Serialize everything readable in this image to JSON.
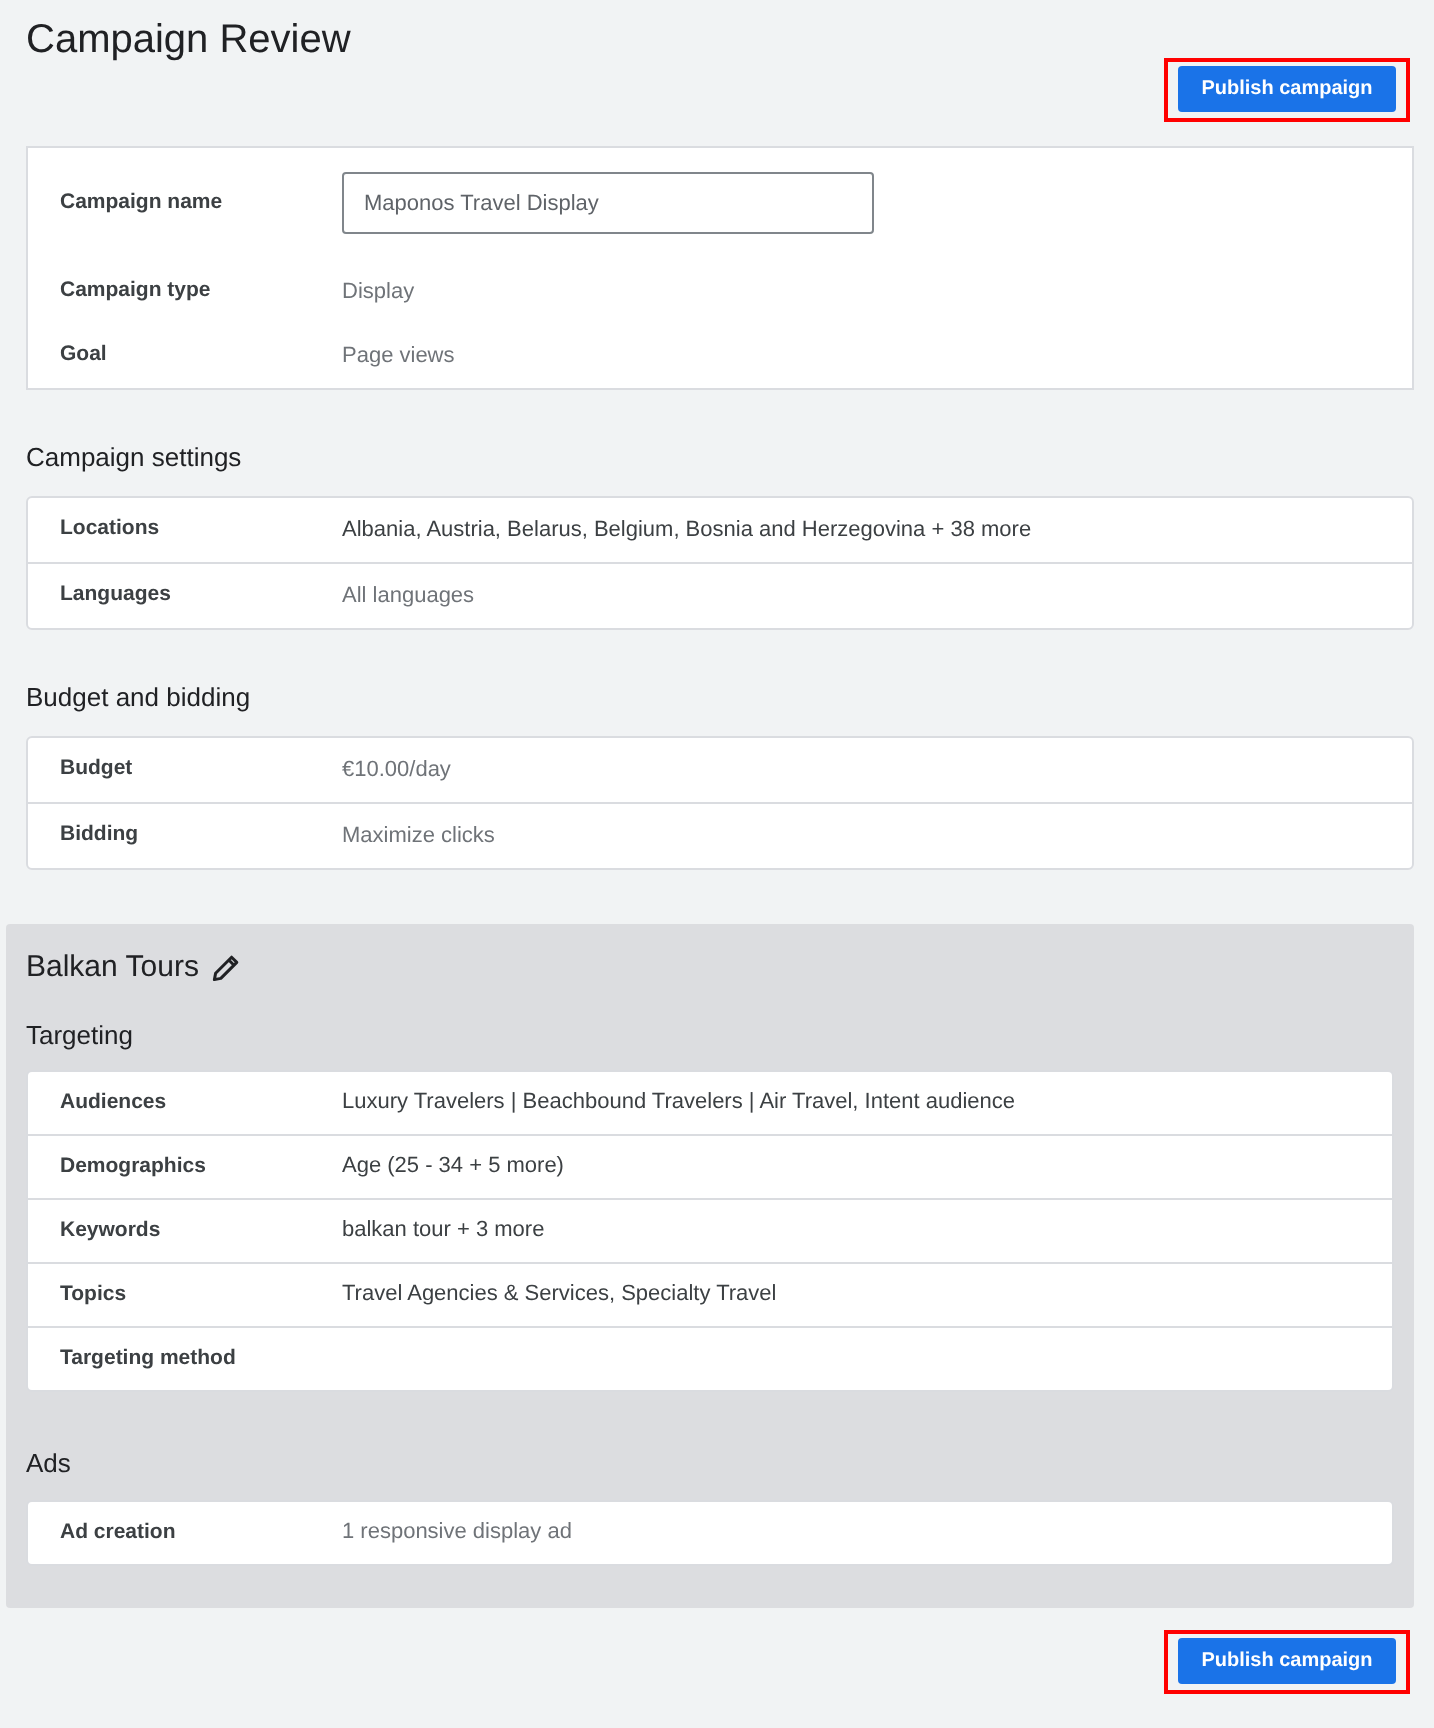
{
  "page": {
    "title": "Campaign Review"
  },
  "publish_top": {
    "label": "Publish campaign",
    "highlighted": true
  },
  "summary": {
    "rows": [
      {
        "kind": "input",
        "label": "Campaign name",
        "value": "Maponos Travel Display"
      },
      {
        "kind": "text",
        "label": "Campaign type",
        "value": "Display",
        "muted": true
      },
      {
        "kind": "text",
        "label": "Goal",
        "value": "Page views",
        "muted": true
      }
    ]
  },
  "sections": [
    {
      "title": "Campaign settings",
      "rows": [
        {
          "label": "Locations",
          "value": "Albania, Austria, Belarus, Belgium, Bosnia and Herzegovina + 38 more",
          "muted": false
        },
        {
          "label": "Languages",
          "value": "All languages",
          "muted": true
        }
      ]
    },
    {
      "title": "Budget and bidding",
      "rows": [
        {
          "label": "Budget",
          "value": "€10.00/day",
          "muted": true
        },
        {
          "label": "Bidding",
          "value": "Maximize clicks",
          "muted": true
        }
      ]
    }
  ],
  "ad_group": {
    "name": "Balkan Tours",
    "sections": [
      {
        "title": "Targeting",
        "rows": [
          {
            "label": "Audiences",
            "value": "Luxury Travelers | Beachbound Travelers | Air Travel, Intent audience",
            "muted": false
          },
          {
            "label": "Demographics",
            "value": "Age (25 - 34 + 5 more)",
            "muted": false
          },
          {
            "label": "Keywords",
            "value": "balkan tour + 3 more",
            "muted": false
          },
          {
            "label": "Topics",
            "value": "Travel Agencies & Services, Specialty Travel",
            "muted": false
          },
          {
            "label": "Targeting method"
          }
        ]
      },
      {
        "title": "Ads",
        "rows": [
          {
            "label": "Ad creation",
            "value": "1 responsive display ad",
            "muted": true
          }
        ]
      }
    ]
  },
  "publish_bottom": {
    "label": "Publish campaign",
    "highlighted": true
  }
}
